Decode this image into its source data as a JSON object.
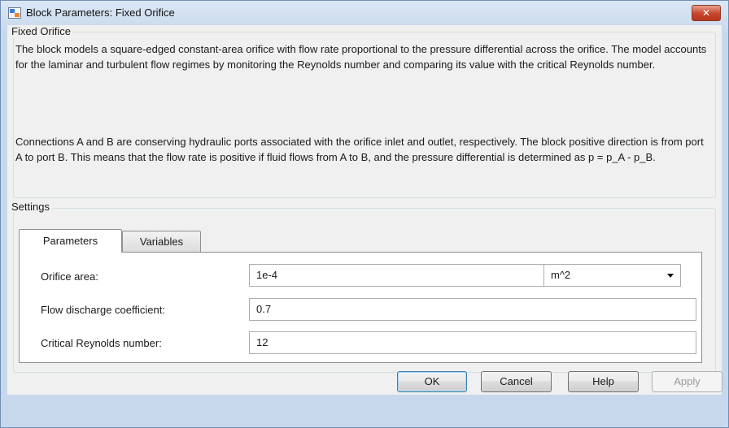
{
  "window": {
    "title": "Block Parameters: Fixed Orifice",
    "close_symbol": "✕",
    "app_icon": "simulink-block-icon"
  },
  "block_group": {
    "title": "Fixed Orifice",
    "paragraphs": [
      "The block models a square-edged constant-area orifice with flow rate proportional to the pressure differential across the orifice. The model accounts for the laminar and turbulent flow regimes by monitoring the Reynolds number and comparing its value with the critical Reynolds number.",
      "Connections A and B are conserving hydraulic ports associated with the orifice inlet and outlet, respectively. The block positive direction is from port A to port B. This means that the flow rate is positive if fluid flows from A to B, and the pressure differential is determined as p = p_A - p_B."
    ]
  },
  "settings_group": {
    "title": "Settings",
    "tabs": [
      {
        "label": "Parameters",
        "active": true
      },
      {
        "label": "Variables",
        "active": false
      }
    ],
    "parameters": [
      {
        "label": "Orifice area:",
        "value": "1e-4",
        "unit": "m^2"
      },
      {
        "label": "Flow discharge coefficient:",
        "value": "0.7"
      },
      {
        "label": "Critical Reynolds number:",
        "value": "12"
      }
    ]
  },
  "buttons": {
    "ok": "OK",
    "cancel": "Cancel",
    "help": "Help",
    "apply": "Apply"
  }
}
